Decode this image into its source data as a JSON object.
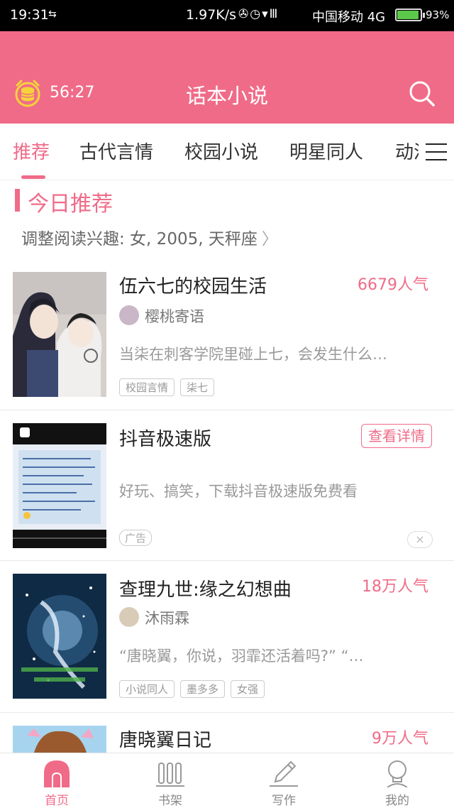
{
  "status_bar": {
    "time": "19:31",
    "notification": "⇆",
    "net_speed": "1.97K/s",
    "icons": "✇◷▾Ⅲ",
    "carrier": "中国移动 4G",
    "battery": "93%",
    "battery_level": 0.93
  },
  "header": {
    "timer": "56:27",
    "title": "话本小说"
  },
  "tabs": [
    {
      "label": "推荐"
    },
    {
      "label": "古代言情"
    },
    {
      "label": "校园小说"
    },
    {
      "label": "明星同人"
    },
    {
      "label": "动漫"
    }
  ],
  "section": {
    "title": "今日推荐",
    "interest": "调整阅读兴趣: 女, 2005, 天秤座",
    "chevron": "〉"
  },
  "books": [
    {
      "title": "伍六七的校园生活",
      "popularity": "6679人气",
      "author": "樱桃寄语",
      "desc": "当柒在刺客学院里碰上七，会发生什么…",
      "tags": [
        "校园言情",
        "柒七"
      ]
    },
    {
      "title": "查理九世:缘之幻想曲",
      "popularity": "18万人气",
      "author": "沐雨霖",
      "desc": "“唐晓翼，你说，羽霏还活着吗?” “…",
      "tags": [
        "小说同人",
        "墨多多",
        "女强"
      ]
    },
    {
      "title": "唐晓翼日记",
      "popularity": "9万人气"
    }
  ],
  "ad": {
    "title": "抖音极速版",
    "button": "查看详情",
    "desc": "好玩、搞笑，下载抖音极速版免费看",
    "badge": "广告",
    "close": "×"
  },
  "bottom_nav": [
    {
      "label": "首页"
    },
    {
      "label": "书架"
    },
    {
      "label": "写作"
    },
    {
      "label": "我的"
    }
  ],
  "colors": {
    "brand": "#f06b88",
    "statusbar": "#000000",
    "text": "#222222"
  }
}
